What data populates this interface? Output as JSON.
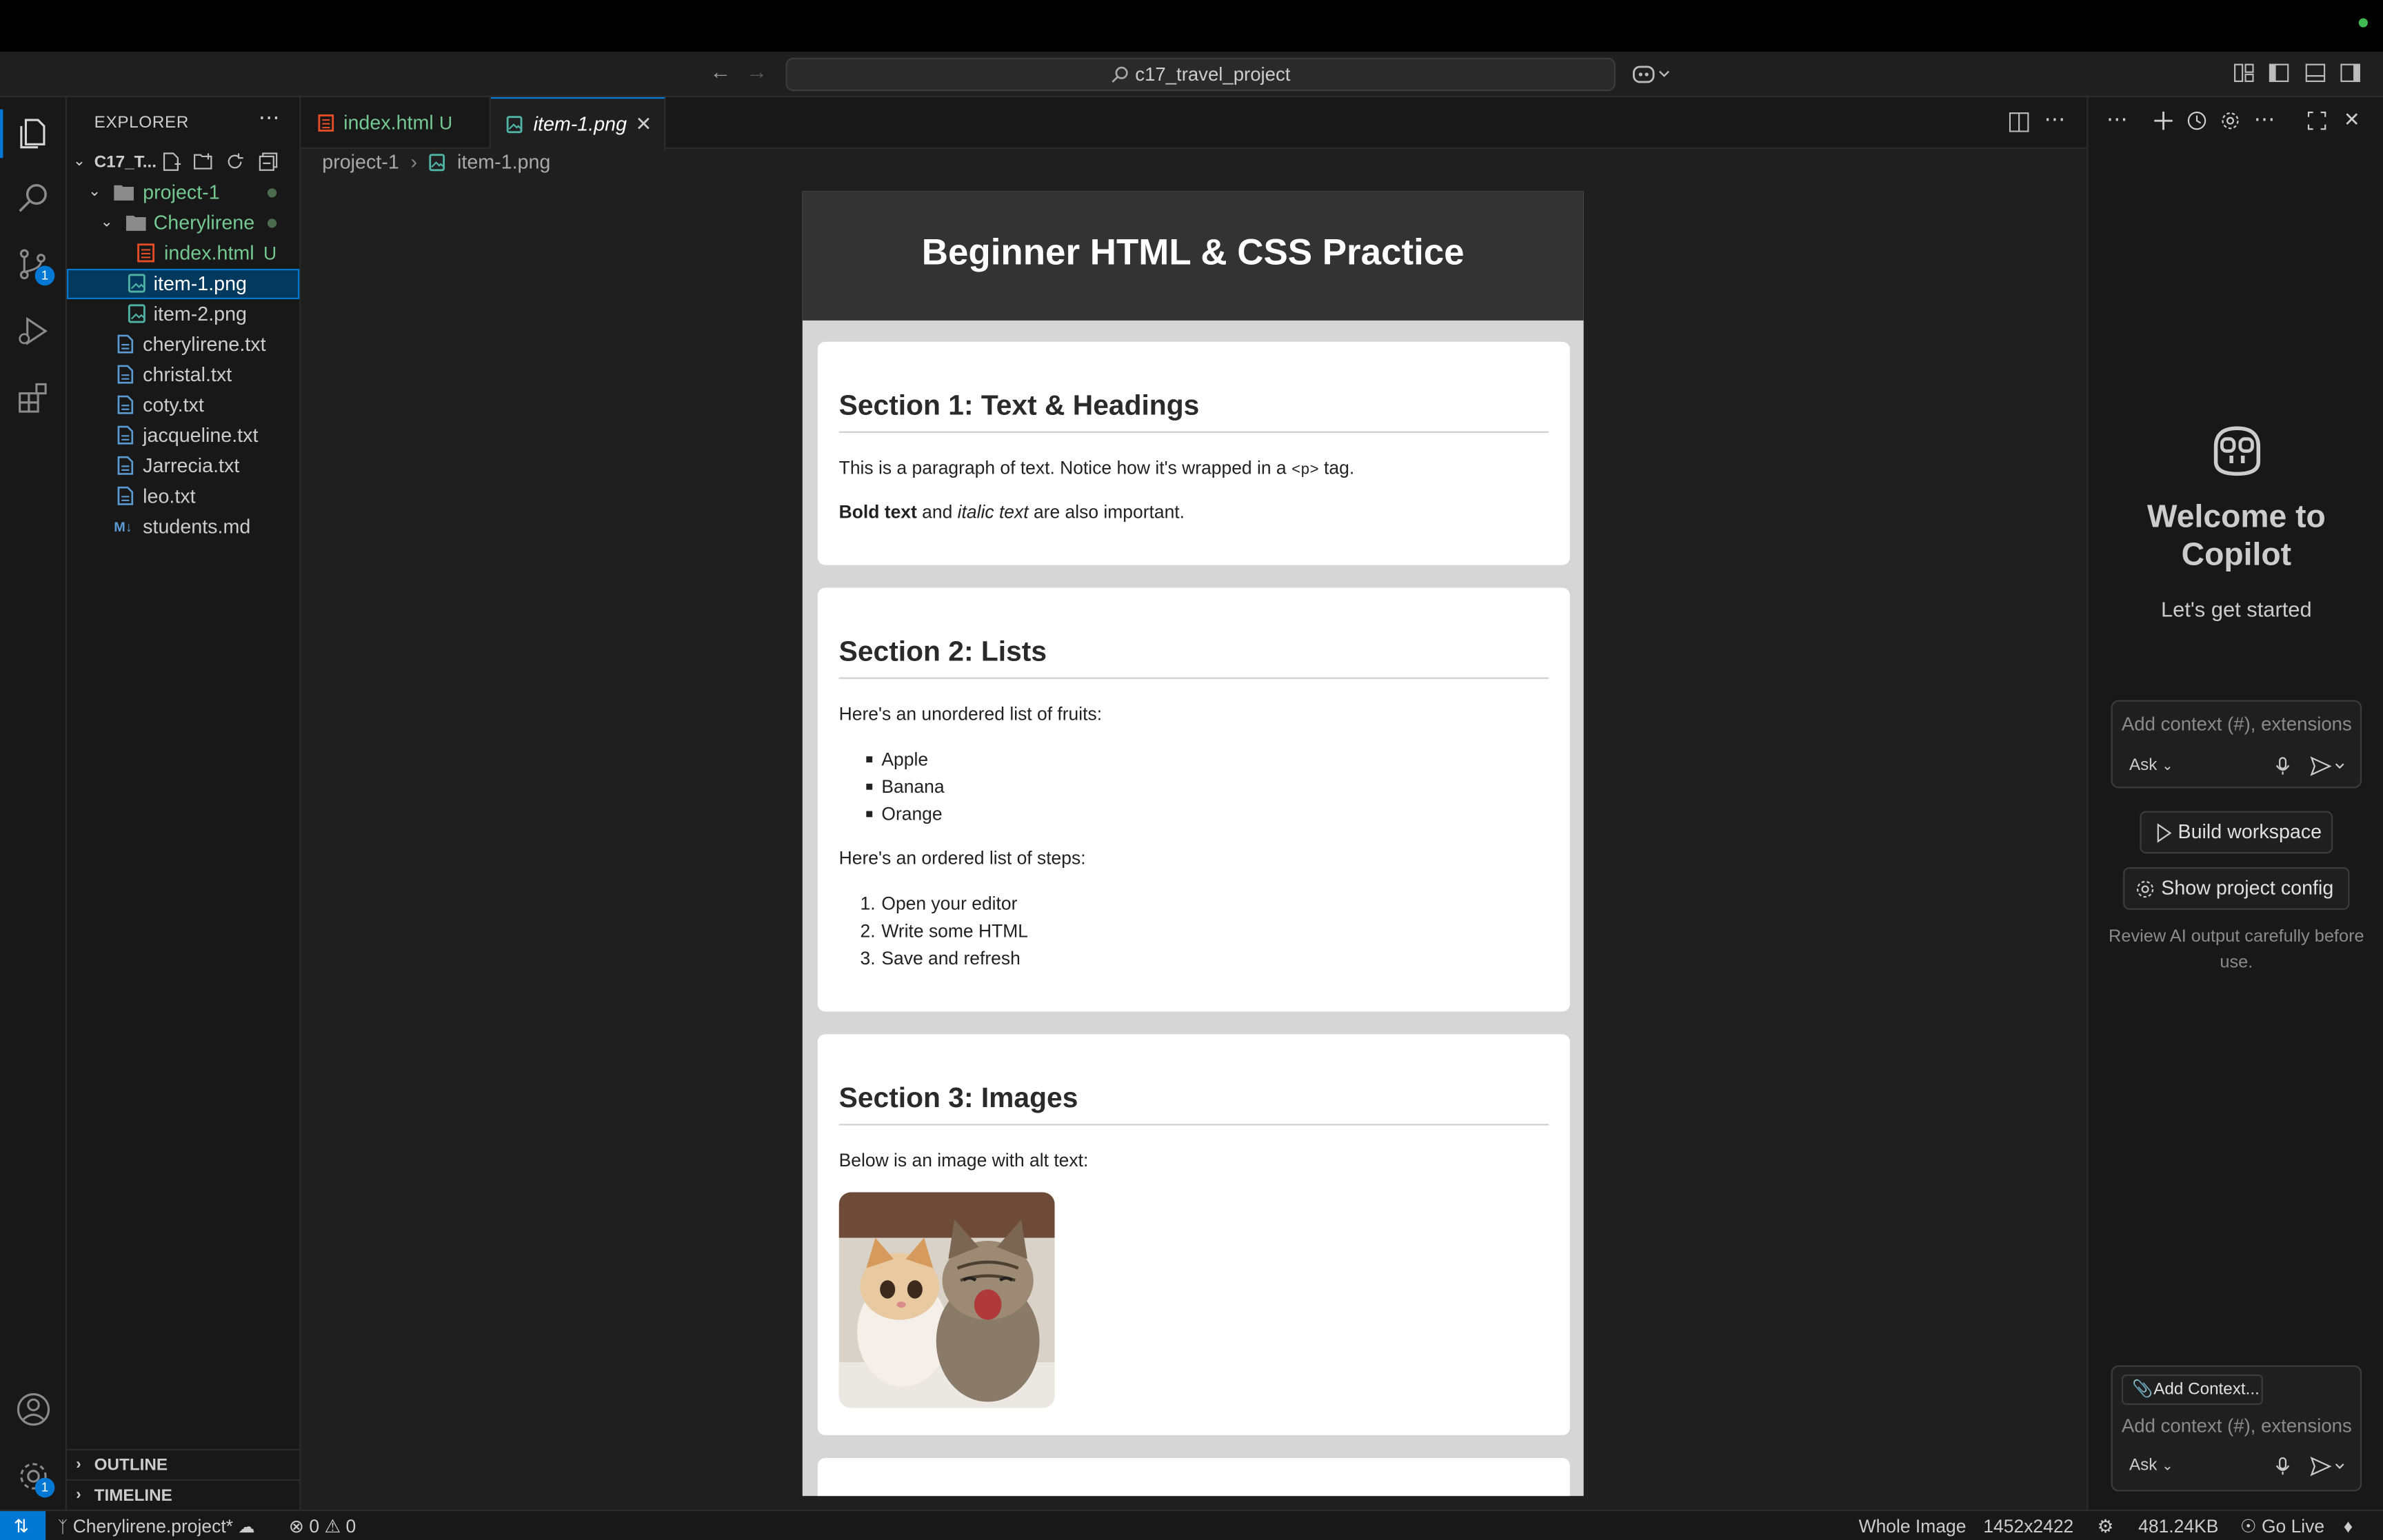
{
  "titlebar": {
    "search_text": "c17_travel_project"
  },
  "activity": {
    "scm_badge": "1",
    "settings_badge": "1"
  },
  "sidebar": {
    "title": "EXPLORER",
    "root": "C17_T...",
    "items": [
      {
        "label": "project-1"
      },
      {
        "label": "Cherylirene"
      },
      {
        "label": "index.html",
        "status": "U"
      },
      {
        "label": "item-1.png"
      },
      {
        "label": "item-2.png"
      },
      {
        "label": "cherylirene.txt"
      },
      {
        "label": "christal.txt"
      },
      {
        "label": "coty.txt"
      },
      {
        "label": "jacqueline.txt"
      },
      {
        "label": "Jarrecia.txt"
      },
      {
        "label": "leo.txt"
      },
      {
        "label": "students.md"
      }
    ],
    "outline": "OUTLINE",
    "timeline": "TIMELINE"
  },
  "tabs": [
    {
      "label": "index.html",
      "status": "U"
    },
    {
      "label": "item-1.png"
    }
  ],
  "breadcrumb": {
    "folder": "project-1",
    "file": "item-1.png"
  },
  "webpage": {
    "title": "Beginner HTML & CSS Practice",
    "section1": {
      "heading": "Section 1: Text & Headings",
      "p1_a": "This is a paragraph of text. Notice how it's wrapped in a ",
      "p1_code": "<p>",
      "p1_b": " tag.",
      "bold": "Bold text",
      "and": " and ",
      "italic": "italic text",
      "rest": " are also important."
    },
    "section2": {
      "heading": "Section 2: Lists",
      "intro_ul": "Here's an unordered list of fruits:",
      "fruits": [
        "Apple",
        "Banana",
        "Orange"
      ],
      "intro_ol": "Here's an ordered list of steps:",
      "steps": [
        "Open your editor",
        "Write some HTML",
        "Save and refresh"
      ]
    },
    "section3": {
      "heading": "Section 3: Images",
      "intro": "Below is an image with alt text:"
    }
  },
  "copilot": {
    "welcome_line1": "Welcome to",
    "welcome_line2": "Copilot",
    "subtitle": "Let's get started",
    "input_placeholder": "Add context (#), extensions",
    "mode": "Ask",
    "build_btn": "Build workspace",
    "config_btn": "Show project config",
    "disclaimer": "Review AI output carefully before use.",
    "add_context_btn": "Add Context...",
    "input2_placeholder": "Add context (#), extensions",
    "mode2": "Ask"
  },
  "status": {
    "branch": "Cherylirene.project*",
    "errors": "0",
    "warnings": "0",
    "view_mode": "Whole Image",
    "dimensions": "1452x2422",
    "filesize": "481.24KB",
    "golive": "Go Live"
  },
  "colors": {
    "accent": "#0078d4",
    "untracked_file": "#73c991",
    "html_icon": "#e44d26"
  }
}
